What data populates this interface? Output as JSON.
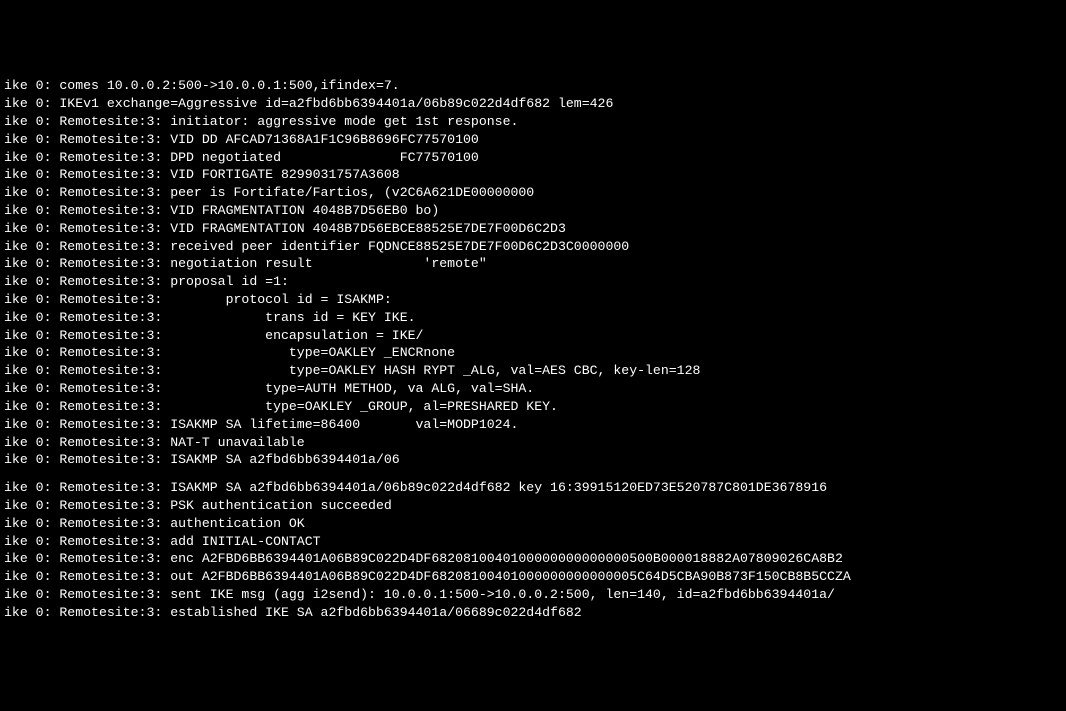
{
  "lines": [
    "ike 0: comes 10.0.0.2:500->10.0.0.1:500,ifindex=7.",
    "ike 0: IKEv1 exchange=Aggressive id=a2fbd6bb6394401a/06b89c022d4df682 lem=426",
    "ike 0: Remotesite:3: initiator: aggressive mode get 1st response.",
    "ike 0: Remotesite:3: VID DD AFCAD71368A1F1C96B8696FC77570100",
    "ike 0: Remotesite:3: DPD negotiated               FC77570100",
    "ike 0: Remotesite:3: VID FORTIGATE 8299031757A3608",
    "ike 0: Remotesite:3: peer is Fortifate/Fartios, (v2C6A621DE00000000",
    "ike 0: Remotesite:3: VID FRAGMENTATION 4048B7D56EB0 bo)",
    "ike 0: Remotesite:3: VID FRAGMENTATION 4048B7D56EBCE88525E7DE7F00D6C2D3",
    "ike 0: Remotesite:3: received peer identifier FQDNCE88525E7DE7F00D6C2D3C0000000",
    "ike 0: Remotesite:3: negotiation result              'remote\"",
    "ike 0: Remotesite:3: proposal id =1:",
    "ike 0: Remotesite:3:        protocol id = ISAKMP:",
    "ike 0: Remotesite:3:             trans id = KEY IKE.",
    "ike 0: Remotesite:3:             encapsulation = IKE/",
    "ike 0: Remotesite:3:                type=OAKLEY _ENCRnone",
    "ike 0: Remotesite:3:                type=OAKLEY HASH RYPT _ALG, val=AES CBC, key-len=128",
    "ike 0: Remotesite:3:             type=AUTH METHOD, va ALG, val=SHA.",
    "ike 0: Remotesite:3:             type=OAKLEY _GROUP, al=PRESHARED KEY.",
    "ike 0: Remotesite:3: ISAKMP SA lifetime=86400       val=MODP1024.",
    "ike 0: Remotesite:3: NAT-T unavailable",
    "ike 0: Remotesite:3: ISAKMP SA a2fbd6bb6394401a/06",
    "",
    "ike 0: Remotesite:3: ISAKMP SA a2fbd6bb6394401a/06b89c022d4df682 key 16:39915120ED73E520787C801DE3678916",
    "ike 0: Remotesite:3: PSK authentication succeeded",
    "ike 0: Remotesite:3: authentication OK",
    "ike 0: Remotesite:3: add INITIAL-CONTACT",
    "ike 0: Remotesite:3: enc A2FBD6BB6394401A06B89C022D4DF6820810040100000000000000500B000018882A07809026CA8B2",
    "ike 0: Remotesite:3: out A2FBD6BB6394401A06B89C022D4DF68208100401000000000000005C64D5CBA90B873F150CB8B5CCZA",
    "ike 0: Remotesite:3: sent IKE msg (agg i2send): 10.0.0.1:500->10.0.0.2:500, len=140, id=a2fbd6bb6394401a/",
    "ike 0: Remotesite:3: established IKE SA a2fbd6bb6394401a/06689c022d4df682"
  ]
}
